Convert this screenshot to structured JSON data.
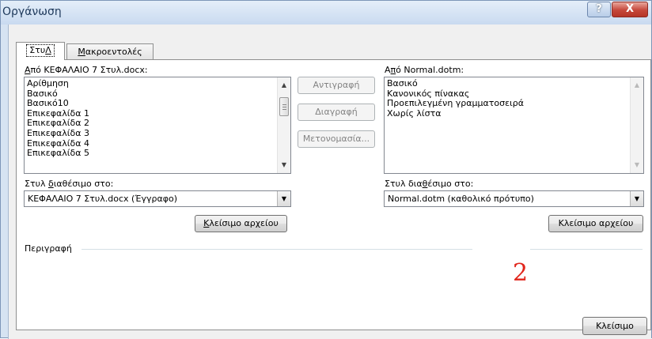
{
  "window": {
    "title": "Οργάνωση",
    "help_glyph": "?",
    "close_glyph": "X"
  },
  "tabs": [
    {
      "label": "Στυλ",
      "underline_char": "Λ",
      "active": true
    },
    {
      "label": "Μακροεντολές",
      "underline_char": "Μ",
      "active": false
    }
  ],
  "left": {
    "from_label_access": "Α",
    "from_label_rest": "πό ΚΕΦΑΛΑΙΟ 7 Στυλ.docx:",
    "items": [
      "Αρίθμηση",
      "Βασικό",
      "Βασικό10",
      "Επικεφαλίδα 1",
      "Επικεφαλίδα 2",
      "Επικεφαλίδα 3",
      "Επικεφαλίδα 4",
      "Επικεφαλίδα 5"
    ],
    "available_label_pre": "Στυλ ",
    "available_label_access": "δ",
    "available_label_post": "ιαθέσιμο στο:",
    "combo_value": "ΚΕΦΑΛΑΙΟ 7 Στυλ.docx (Έγγραφο)",
    "close_file_access": "Κ",
    "close_file_rest": "λείσιμο αρχείου"
  },
  "middle": {
    "copy": "Αντιγραφή",
    "delete": "Διαγραφή",
    "rename": "Μετονομασία..."
  },
  "right": {
    "from_label_pre": "Α",
    "from_label_access": "π",
    "from_label_post": "ό Normal.dotm:",
    "items": [
      "Βασικό",
      "Κανονικός πίνακας",
      "Προεπιλεγμένη γραμματοσειρά",
      "Χωρίς λίστα"
    ],
    "available_label_pre": "Στυλ δια",
    "available_label_access": "θ",
    "available_label_post": "έσιμο στο:",
    "combo_value": "Normal.dotm (καθολικό πρότυπο)",
    "close_file": "Κλείσιμο αρχείου"
  },
  "description": {
    "label": "Περιγραφή"
  },
  "annotation": "2",
  "footer": {
    "close": "Κλείσιμο"
  },
  "icons": {
    "scroll_up": "▲",
    "scroll_down": "▼",
    "combo_arrow": "▼"
  }
}
